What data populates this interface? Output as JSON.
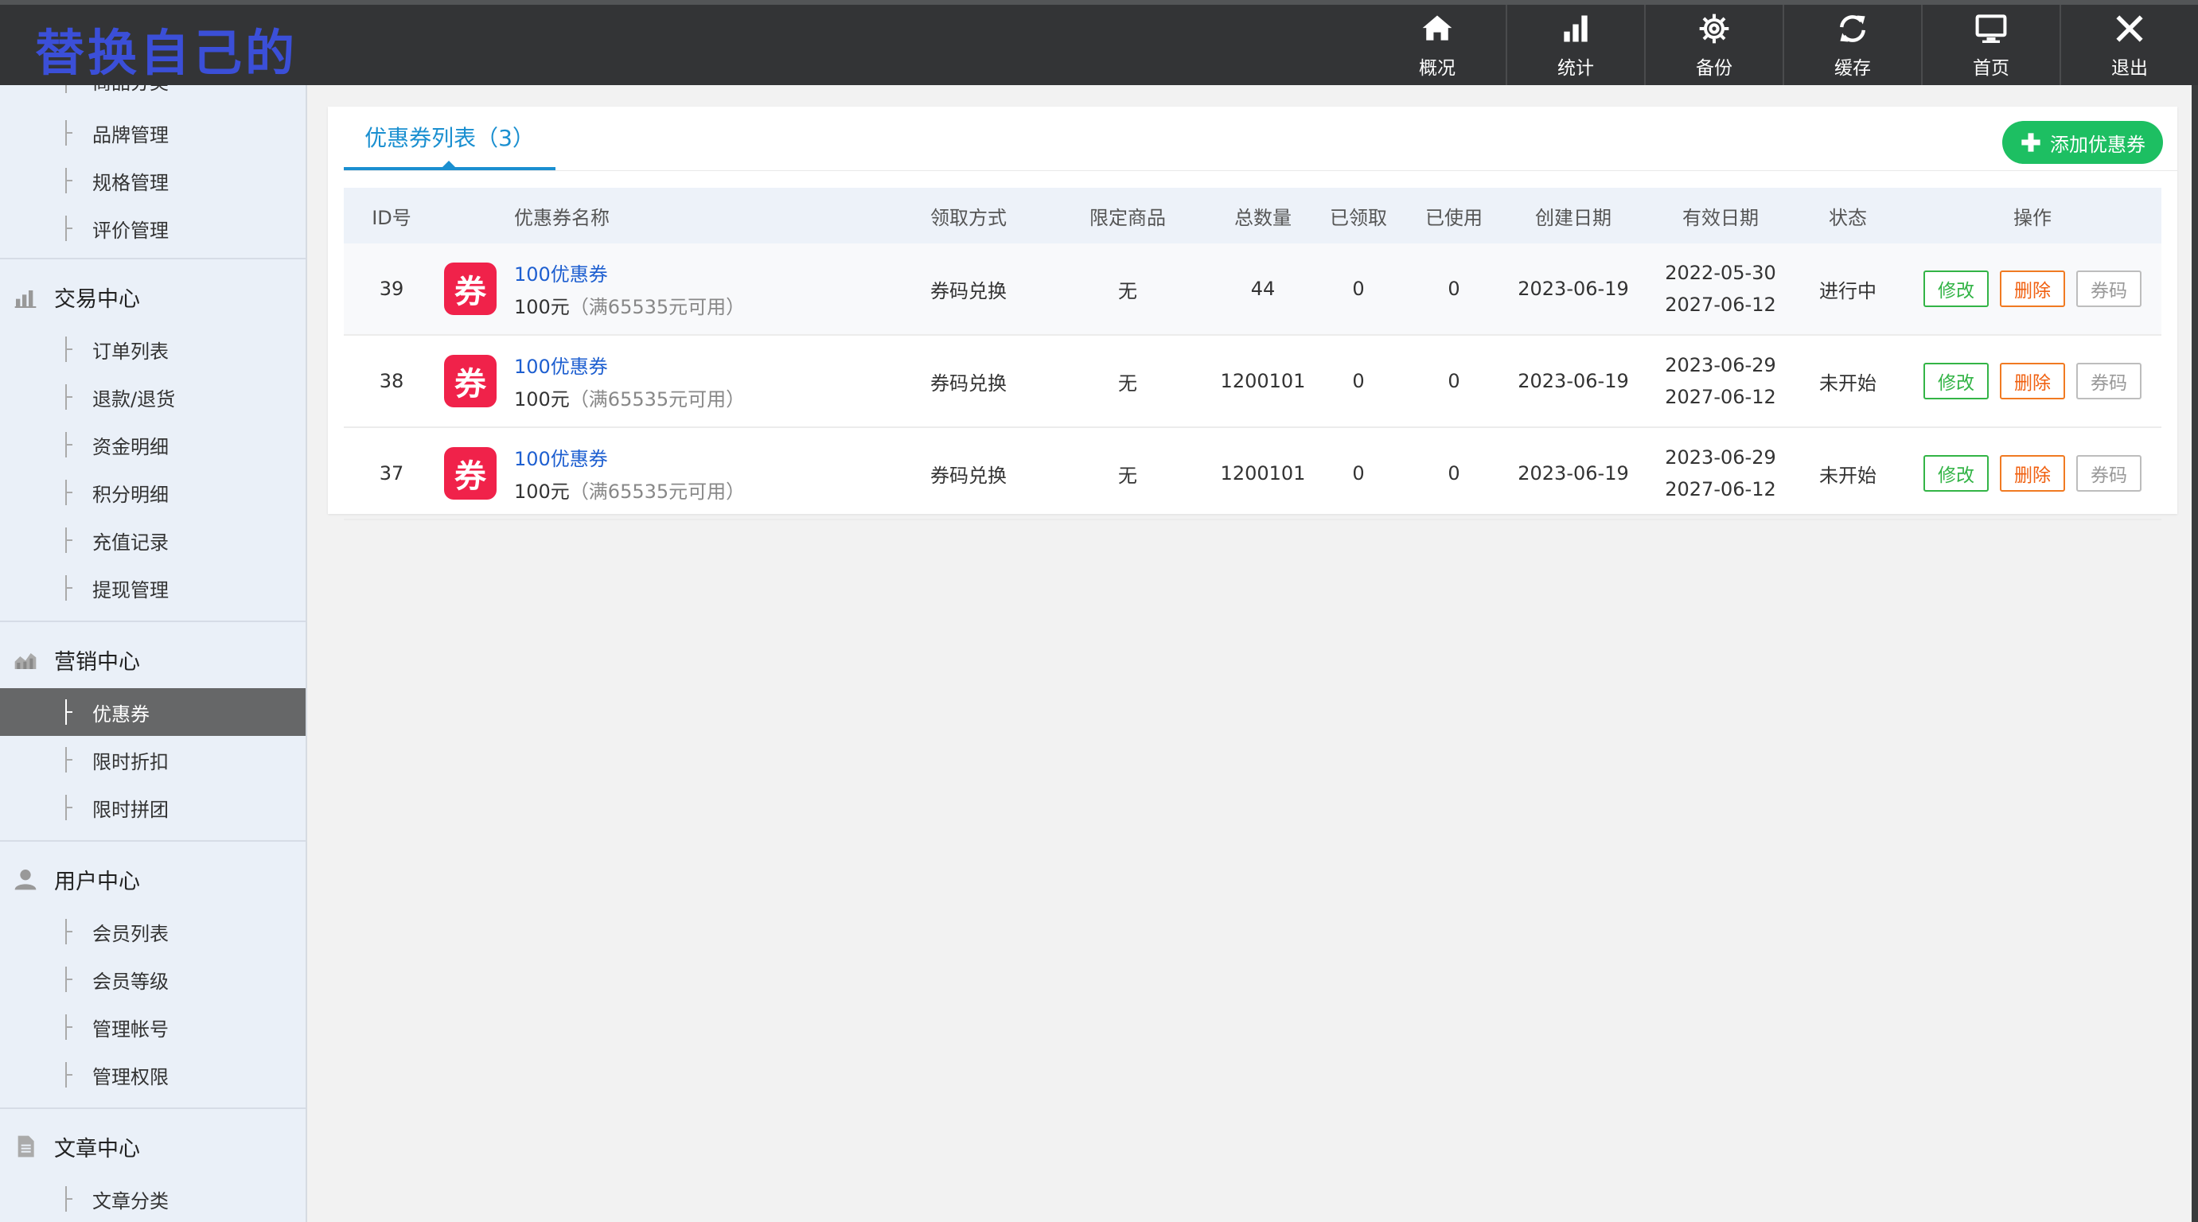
{
  "logo": "替换自己的",
  "topnav": [
    {
      "label": "概况",
      "icon": "home-icon"
    },
    {
      "label": "统计",
      "icon": "bar-chart-icon"
    },
    {
      "label": "备份",
      "icon": "gear-icon"
    },
    {
      "label": "缓存",
      "icon": "refresh-icon"
    },
    {
      "label": "首页",
      "icon": "monitor-icon"
    },
    {
      "label": "退出",
      "icon": "close-icon"
    }
  ],
  "sidebar": {
    "partial_top": "商品分类",
    "goods_items": [
      "品牌管理",
      "规格管理",
      "评价管理"
    ],
    "trade": {
      "title": "交易中心",
      "icon": "bar-chart-icon",
      "items": [
        "订单列表",
        "退款/退货",
        "资金明细",
        "积分明细",
        "充值记录",
        "提现管理"
      ]
    },
    "marketing": {
      "title": "营销中心",
      "icon": "area-chart-icon",
      "items": [
        "优惠券",
        "限时折扣",
        "限时拼团"
      ],
      "active": "优惠券"
    },
    "user": {
      "title": "用户中心",
      "icon": "user-icon",
      "items": [
        "会员列表",
        "会员等级",
        "管理帐号",
        "管理权限"
      ]
    },
    "article": {
      "title": "文章中心",
      "icon": "document-icon",
      "items": [
        "文章分类"
      ]
    }
  },
  "main": {
    "tab_label": "优惠券列表（3）",
    "add_button": "添加优惠券",
    "columns": [
      "ID号",
      "优惠券名称",
      "领取方式",
      "限定商品",
      "总数量",
      "已领取",
      "已使用",
      "创建日期",
      "有效日期",
      "状态",
      "操作"
    ],
    "coupon_icon_text": "券",
    "rows": [
      {
        "id": "39",
        "name": "100优惠券",
        "amount": "100元",
        "condition": "（满65535元可用）",
        "method": "券码兑换",
        "limited": "无",
        "total": "44",
        "received": "0",
        "used": "0",
        "created": "2023-06-19",
        "valid_from": "2022-05-30",
        "valid_to": "2027-06-12",
        "status": "进行中",
        "status_color": "#23a835"
      },
      {
        "id": "38",
        "name": "100优惠券",
        "amount": "100元",
        "condition": "（满65535元可用）",
        "method": "券码兑换",
        "limited": "无",
        "total": "1200101",
        "received": "0",
        "used": "0",
        "created": "2023-06-19",
        "valid_from": "2023-06-29",
        "valid_to": "2027-06-12",
        "status": "未开始",
        "status_color": "#f05a0a"
      },
      {
        "id": "37",
        "name": "100优惠券",
        "amount": "100元",
        "condition": "（满65535元可用）",
        "method": "券码兑换",
        "limited": "无",
        "total": "1200101",
        "received": "0",
        "used": "0",
        "created": "2023-06-19",
        "valid_from": "2023-06-29",
        "valid_to": "2027-06-12",
        "status": "未开始",
        "status_color": "#f05a0a"
      }
    ],
    "actions": {
      "edit": "修改",
      "delete": "删除",
      "code": "券码"
    }
  }
}
